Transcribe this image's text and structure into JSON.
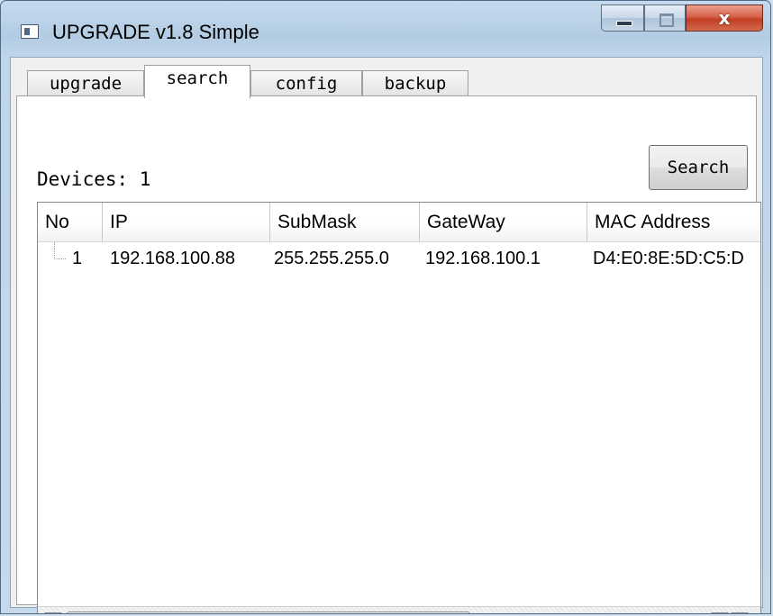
{
  "window": {
    "title": "UPGRADE v1.8 Simple",
    "close_glyph": "x",
    "caption_icons": [
      "minimize-icon",
      "maximize-icon",
      "close-icon"
    ]
  },
  "tabs": [
    {
      "label": "upgrade",
      "active": false
    },
    {
      "label": "search",
      "active": true
    },
    {
      "label": "config",
      "active": false
    },
    {
      "label": "backup",
      "active": false
    }
  ],
  "search_panel": {
    "devices_label": "Devices: 1",
    "search_button": "Search",
    "table": {
      "columns": [
        "No",
        "IP",
        "SubMask",
        "GateWay",
        "MAC Address"
      ],
      "rows": [
        {
          "no": "1",
          "ip": "192.168.100.88",
          "submask": "255.255.255.0",
          "gateway": "192.168.100.1",
          "mac": "D4:E0:8E:5D:C5:D"
        }
      ]
    },
    "scrollbar": {
      "left_arrow": "◀",
      "right_arrow": "▶"
    }
  },
  "colors": {
    "title_bar": "#b3cce3",
    "close_button": "#c13e24",
    "panel_background": "#ffffff",
    "dialog_background": "#f0f0f0"
  }
}
